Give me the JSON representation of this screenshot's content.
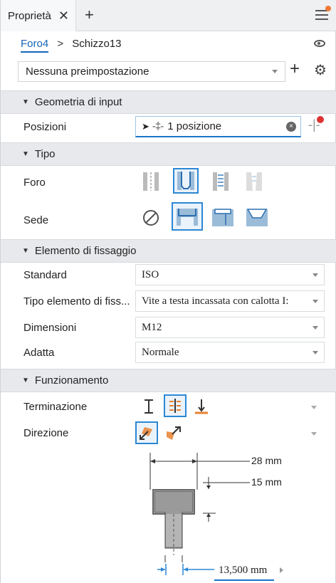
{
  "tab": {
    "title": "Proprietà",
    "close": "✕",
    "add": "+"
  },
  "breadcrumb": {
    "feature": "Foro4",
    "separator": ">",
    "sketch": "Schizzo13"
  },
  "preset": {
    "value": "Nessuna preimpostazione",
    "add": "+",
    "settings": "⚙"
  },
  "sections": {
    "input_geometry": {
      "label": "Geometria di input"
    },
    "type": {
      "label": "Tipo"
    },
    "fastener": {
      "label": "Elemento di fissaggio"
    },
    "behavior": {
      "label": "Funzionamento"
    }
  },
  "positions": {
    "label": "Posizioni",
    "value": "1 posizione",
    "clear": "×"
  },
  "type": {
    "hole_label": "Foro",
    "seat_label": "Sede"
  },
  "fastener": {
    "standard_label": "Standard",
    "standard_value": "ISO",
    "type_label": "Tipo elemento di fiss...",
    "type_value": "Vite a testa incassata con calotta I:",
    "size_label": "Dimensioni",
    "size_value": "M12",
    "fit_label": "Adatta",
    "fit_value": "Normale"
  },
  "behavior": {
    "termination_label": "Terminazione",
    "direction_label": "Direzione"
  },
  "dimensions": {
    "cbore_diameter": "28 mm",
    "cbore_depth": "15 mm",
    "hole_diameter": "13,500 mm"
  },
  "colors": {
    "accent": "#1b74c9",
    "selected_border": "#2c87d4",
    "section_bg": "#e7e9ec",
    "orange": "#e8812f"
  }
}
